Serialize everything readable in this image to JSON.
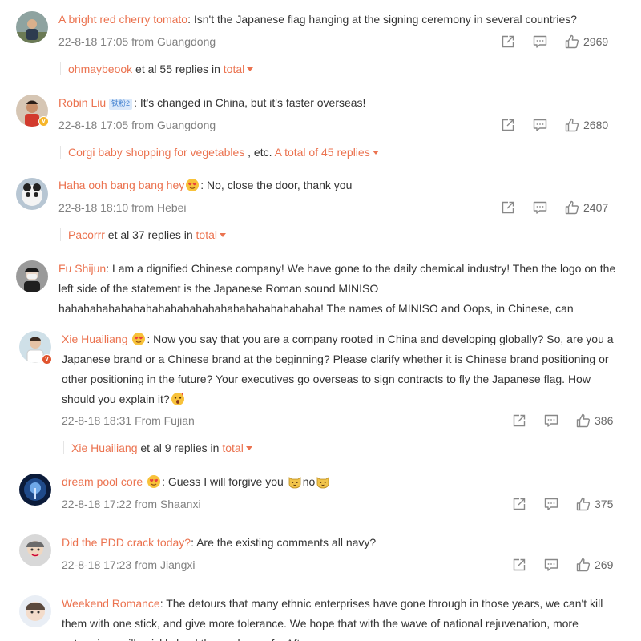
{
  "comments": [
    {
      "name": "A bright red cherry tomato",
      "text": ": Isn't the Japanese flag hanging at the signing ceremony in several countries?",
      "date": "22-8-18 17:05",
      "location": "from Guangdong",
      "likes": "2969",
      "reply_user": "ohmaybeook",
      "reply_text": " et al 55 replies in ",
      "reply_link": "total"
    },
    {
      "name": "Robin Liu",
      "tag": "铁粉2",
      "text": ": It's changed in China, but it's faster overseas!",
      "date": "22-8-18 17:05",
      "location": "from Guangdong",
      "likes": "2680",
      "reply_user": "Corgi baby shopping for vegetables",
      "reply_text": " , etc. ",
      "reply_link": "A total of 45 replies"
    },
    {
      "name": "Haha ooh bang bang hey",
      "text": ": No, close the door, thank you",
      "date": "22-8-18 18:10",
      "location": "from Hebei",
      "likes": "2407",
      "reply_user": "Pacorrr",
      "reply_text": " et al 37 replies in ",
      "reply_link": "total"
    },
    {
      "name": "Fu Shijun",
      "text": ": I am a dignified Chinese company! We have gone to the daily chemical industry! Then the logo on the left side of the statement is the Japanese Roman sound MINISO hahahahahahahahahahahahahahahahahahahahaha! The names of MINISO and Oops, in Chinese, can"
    },
    {
      "name": "Xie Huailiang",
      "text": ": Now you say that you are a company rooted in China and developing globally? So, are you a Japanese brand or a Chinese brand at the beginning? Please clarify whether it is Chinese brand positioning or other positioning in the future? Your executives go overseas to sign contracts to fly the Japanese flag. How should you explain it?",
      "date": "22-8-18 18:31",
      "location": "From Fujian",
      "likes": "386",
      "reply_user": "Xie Huailiang",
      "reply_text": " et al 9 replies in ",
      "reply_link": "total"
    },
    {
      "name": "dream pool core",
      "text_a": ": Guess I will forgive you ",
      "text_b": "no",
      "date": "22-8-18 17:22",
      "location": "from Shaanxi",
      "likes": "375"
    },
    {
      "name": "Did the PDD crack today?",
      "text": ": Are the existing comments all navy?",
      "date": "22-8-18 17:23",
      "location": "from Jiangxi",
      "likes": "269"
    },
    {
      "name": "Weekend Romance",
      "text": ": The detours that many ethnic enterprises have gone through in those years, we can't kill them with one stick, and give more tolerance. We hope that with the wave of national rejuvenation, more enterprises will quickly land the package of... Afte..."
    }
  ],
  "colors": {
    "accent": "#eb7350",
    "meta": "#808080",
    "text": "#333333"
  },
  "icons": {
    "share": "share-icon",
    "comment": "comment-icon",
    "like": "thumbs-up-icon"
  }
}
